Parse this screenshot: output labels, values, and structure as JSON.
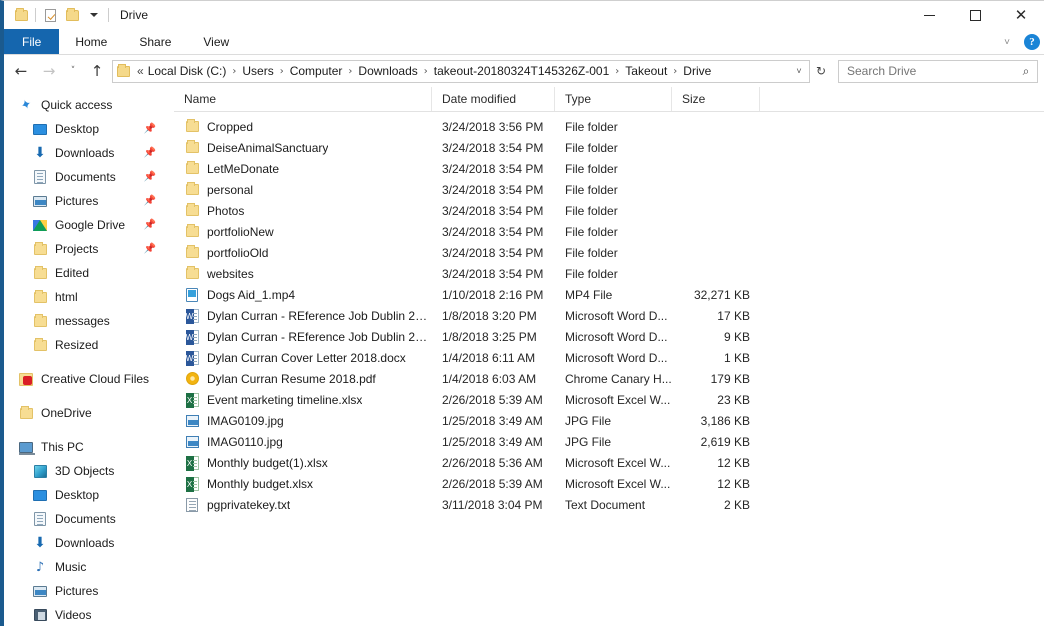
{
  "window": {
    "title": "Drive",
    "quick_access_toolbar": [
      {
        "name": "folder-properties-icon",
        "label": "Properties"
      },
      {
        "name": "new-folder-icon",
        "label": "New folder"
      }
    ],
    "controls": {
      "minimize": "–",
      "maximize": "☐",
      "close": "✕"
    }
  },
  "ribbon": {
    "tabs": [
      {
        "label": "File",
        "active": true
      },
      {
        "label": "Home",
        "active": false
      },
      {
        "label": "Share",
        "active": false
      },
      {
        "label": "View",
        "active": false
      }
    ],
    "expand_chevron": "˅",
    "help_label": "?"
  },
  "addressbar": {
    "back": "←",
    "forward": "→",
    "recent": "˅",
    "up": "↑",
    "lead": "«",
    "crumbs": [
      "Local Disk (C:)",
      "Users",
      "Computer",
      "Downloads",
      "takeout-20180324T145326Z-001",
      "Takeout",
      "Drive"
    ],
    "separator": "›",
    "dropdown": "˅",
    "refresh": "↻"
  },
  "search": {
    "placeholder": "Search Drive",
    "value": "",
    "icon": "⌕"
  },
  "sidebar": {
    "groups": [
      {
        "header": {
          "label": "Quick access",
          "icon": "star-icon"
        },
        "items": [
          {
            "label": "Desktop",
            "icon": "monitor-icon",
            "pinned": true
          },
          {
            "label": "Downloads",
            "icon": "download-arrow-icon",
            "pinned": true
          },
          {
            "label": "Documents",
            "icon": "document-icon",
            "pinned": true
          },
          {
            "label": "Pictures",
            "icon": "picture-icon",
            "pinned": true
          },
          {
            "label": "Google Drive",
            "icon": "google-drive-icon",
            "pinned": true
          },
          {
            "label": "Projects",
            "icon": "folder-icon",
            "pinned": true
          },
          {
            "label": "Edited",
            "icon": "folder-icon",
            "pinned": false
          },
          {
            "label": "html",
            "icon": "folder-icon",
            "pinned": false
          },
          {
            "label": "messages",
            "icon": "folder-icon",
            "pinned": false
          },
          {
            "label": "Resized",
            "icon": "folder-icon",
            "pinned": false
          }
        ]
      },
      {
        "header": {
          "label": "Creative Cloud Files",
          "icon": "creative-cloud-icon"
        },
        "items": []
      },
      {
        "header": {
          "label": "OneDrive",
          "icon": "folder-icon"
        },
        "items": []
      },
      {
        "header": {
          "label": "This PC",
          "icon": "this-pc-icon"
        },
        "items": [
          {
            "label": "3D Objects",
            "icon": "3d-objects-icon",
            "pinned": false
          },
          {
            "label": "Desktop",
            "icon": "monitor-icon",
            "pinned": false
          },
          {
            "label": "Documents",
            "icon": "document-icon",
            "pinned": false
          },
          {
            "label": "Downloads",
            "icon": "download-arrow-icon",
            "pinned": false
          },
          {
            "label": "Music",
            "icon": "music-note-icon",
            "pinned": false
          },
          {
            "label": "Pictures",
            "icon": "picture-icon",
            "pinned": false
          },
          {
            "label": "Videos",
            "icon": "video-icon",
            "pinned": false
          }
        ]
      }
    ],
    "pin_glyph": "📌"
  },
  "filelist": {
    "columns": [
      {
        "label": "Name",
        "sorted": "asc"
      },
      {
        "label": "Date modified",
        "sorted": ""
      },
      {
        "label": "Type",
        "sorted": ""
      },
      {
        "label": "Size",
        "sorted": ""
      }
    ],
    "sort_glyph": "⌃",
    "rows": [
      {
        "name": "Cropped",
        "date": "3/24/2018 3:56 PM",
        "type": "File folder",
        "size": "",
        "icon": "folder"
      },
      {
        "name": "DeiseAnimalSanctuary",
        "date": "3/24/2018 3:54 PM",
        "type": "File folder",
        "size": "",
        "icon": "folder"
      },
      {
        "name": "LetMeDonate",
        "date": "3/24/2018 3:54 PM",
        "type": "File folder",
        "size": "",
        "icon": "folder"
      },
      {
        "name": "personal",
        "date": "3/24/2018 3:54 PM",
        "type": "File folder",
        "size": "",
        "icon": "folder"
      },
      {
        "name": "Photos",
        "date": "3/24/2018 3:54 PM",
        "type": "File folder",
        "size": "",
        "icon": "folder"
      },
      {
        "name": "portfolioNew",
        "date": "3/24/2018 3:54 PM",
        "type": "File folder",
        "size": "",
        "icon": "folder"
      },
      {
        "name": "portfolioOld",
        "date": "3/24/2018 3:54 PM",
        "type": "File folder",
        "size": "",
        "icon": "folder"
      },
      {
        "name": "websites",
        "date": "3/24/2018 3:54 PM",
        "type": "File folder",
        "size": "",
        "icon": "folder"
      },
      {
        "name": "Dogs Aid_1.mp4",
        "date": "1/10/2018 2:16 PM",
        "type": "MP4 File",
        "size": "32,271 KB",
        "icon": "mp4"
      },
      {
        "name": "Dylan Curran - REference Job Dublin 201...",
        "date": "1/8/2018 3:20 PM",
        "type": "Microsoft Word D...",
        "size": "17 KB",
        "icon": "word"
      },
      {
        "name": "Dylan Curran - REference Job Dublin 201...",
        "date": "1/8/2018 3:25 PM",
        "type": "Microsoft Word D...",
        "size": "9 KB",
        "icon": "word"
      },
      {
        "name": "Dylan Curran Cover Letter 2018.docx",
        "date": "1/4/2018 6:11 AM",
        "type": "Microsoft Word D...",
        "size": "1 KB",
        "icon": "word"
      },
      {
        "name": "Dylan Curran Resume 2018.pdf",
        "date": "1/4/2018 6:03 AM",
        "type": "Chrome Canary H...",
        "size": "179 KB",
        "icon": "pdf"
      },
      {
        "name": "Event marketing timeline.xlsx",
        "date": "2/26/2018 5:39 AM",
        "type": "Microsoft Excel W...",
        "size": "23 KB",
        "icon": "excel"
      },
      {
        "name": "IMAG0109.jpg",
        "date": "1/25/2018 3:49 AM",
        "type": "JPG File",
        "size": "3,186 KB",
        "icon": "jpg"
      },
      {
        "name": "IMAG0110.jpg",
        "date": "1/25/2018 3:49 AM",
        "type": "JPG File",
        "size": "2,619 KB",
        "icon": "jpg"
      },
      {
        "name": "Monthly budget(1).xlsx",
        "date": "2/26/2018 5:36 AM",
        "type": "Microsoft Excel W...",
        "size": "12 KB",
        "icon": "excel"
      },
      {
        "name": "Monthly budget.xlsx",
        "date": "2/26/2018 5:39 AM",
        "type": "Microsoft Excel W...",
        "size": "12 KB",
        "icon": "excel"
      },
      {
        "name": "pgprivatekey.txt",
        "date": "3/11/2018 3:04 PM",
        "type": "Text Document",
        "size": "2 KB",
        "icon": "txt"
      }
    ]
  },
  "colors": {
    "accent": "#1566ae",
    "window_frame": "#1b5a8e",
    "folder": "#f7dd93",
    "selection": "#e5f1fb"
  }
}
